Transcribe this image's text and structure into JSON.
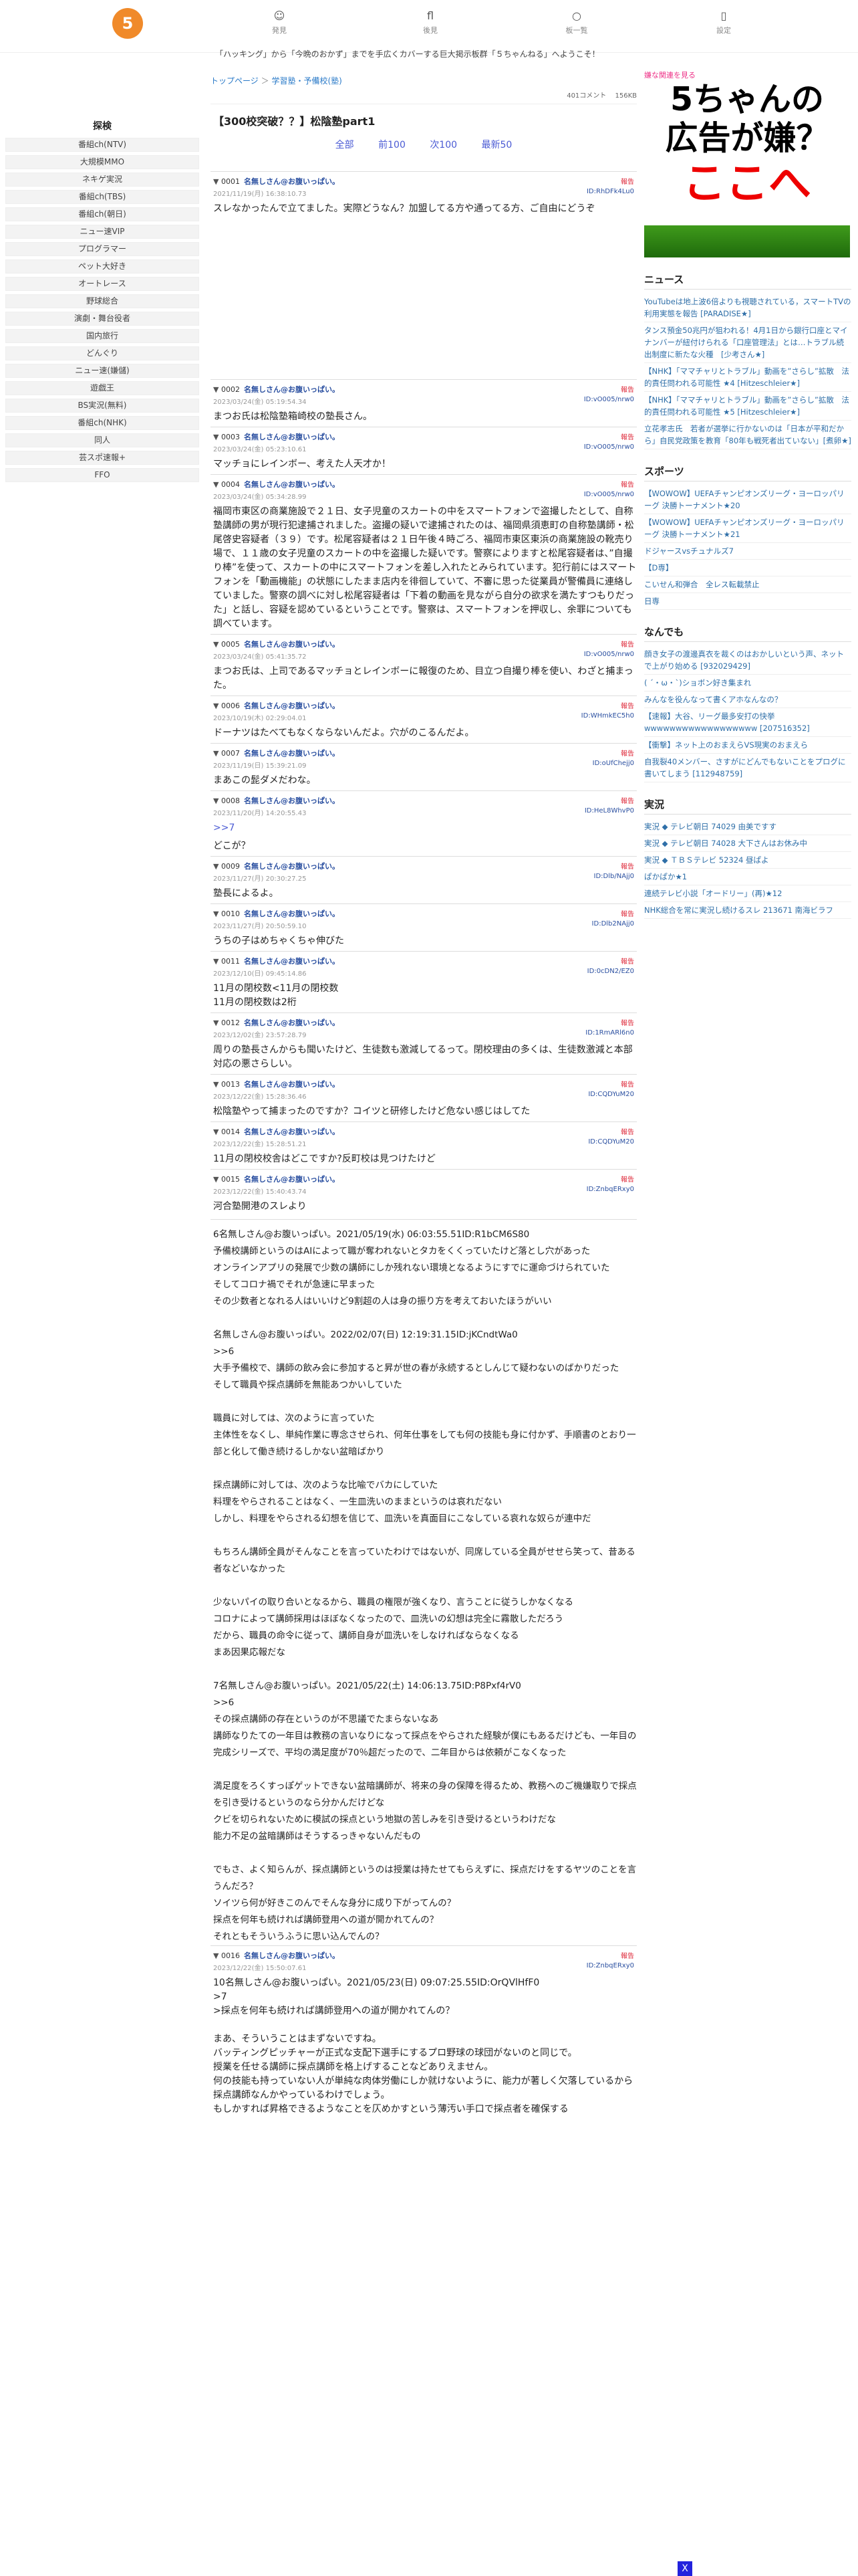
{
  "header": {
    "logo": "5",
    "nav": [
      {
        "icon": "☺",
        "label": "発見"
      },
      {
        "icon": "fl",
        "label": "後見"
      },
      {
        "icon": "○",
        "label": "板一覧"
      },
      {
        "icon": "▯",
        "label": "設定"
      }
    ],
    "ticker": "「ハッキング」から「今晩のおかず」までを手広くカバーする巨大掲示板群「５ちゃんねる」へようこそ！"
  },
  "left": {
    "title": "探検",
    "cats": [
      "番組ch(NTV)",
      "大規模MMO",
      "ネキゲ実況",
      "番組ch(TBS)",
      "番組ch(朝日)",
      "ニュー速VIP",
      "プログラマー",
      "ペット大好き",
      "オートレース",
      "野球総合",
      "演劇・舞台役者",
      "国内旅行",
      "どんぐり",
      "ニュー速(嫌儲)",
      "遊戯王",
      "BS実況(無料)",
      "番組ch(NHK)",
      "同人",
      "芸スポ速報+",
      "FFO"
    ]
  },
  "main": {
    "crumb_top": "トップページ",
    "crumb_sep": "＞",
    "crumb_board": "学習塾・予備校(塾)",
    "comments": "401コメント",
    "size": "156KB",
    "title": "【300校突破？？】松陰塾part1",
    "pager": [
      "全部",
      "前100",
      "次100",
      "最新50"
    ],
    "posts": [
      {
        "no": "0001",
        "name": "名無しさん@お腹いっぱい。",
        "date": "2021/11/19(月) 16:38:10.73",
        "id": "ID:RhDFk4Lu0",
        "body": "スレなかったんで立てました。実際どうなん？加盟してる方や通ってる方、ご自由にどうぞ",
        "tall": true
      },
      {
        "no": "0002",
        "name": "名無しさん@お腹いっぱい。",
        "date": "2023/03/24(金) 05:19:54.34",
        "id": "ID:vO005/nrw0",
        "body": "まつお氏は松陰塾箱崎校の塾長さん。"
      },
      {
        "no": "0003",
        "name": "名無しさん@お腹いっぱい。",
        "date": "2023/03/24(金) 05:23:10.61",
        "id": "ID:vO005/nrw0",
        "body": "マッチョにレインボー、考えた人天才か！"
      },
      {
        "no": "0004",
        "name": "名無しさん@お腹いっぱい。",
        "date": "2023/03/24(金) 05:34:28.99",
        "id": "ID:vO005/nrw0",
        "body": "福岡市東区の商業施設で２１日、女子児童のスカートの中をスマートフォンで盗撮したとして、自称塾講師の男が現行犯逮捕されました。盗撮の疑いで逮捕されたのは、福岡県須恵町の自称塾講師・松尾啓史容疑者（３９）です。松尾容疑者は２１日午後４時ごろ、福岡市東区東浜の商業施設の靴売り場で、１１歳の女子児童のスカートの中を盗撮した疑いです。警察によりますと松尾容疑者は、”自撮り棒”を使って、スカートの中にスマートフォンを差し入れたとみられています。犯行前にはスマートフォンを「動画機能」の状態にしたまま店内を徘徊していて、不審に思った従業員が警備員に連絡していました。警察の調べに対し松尾容疑者は「下着の動画を見ながら自分の欲求を満たすつもりだった」と話し、容疑を認めているということです。警察は、スマートフォンを押収し、余罪についても調べています。"
      },
      {
        "no": "0005",
        "name": "名無しさん@お腹いっぱい。",
        "date": "2023/03/24(金) 05:41:35.72",
        "id": "ID:vO005/nrw0",
        "body": "まつお氏は、上司であるマッチョとレインボーに報復のため、目立つ自撮り棒を使い、わざと捕まった。"
      },
      {
        "no": "0006",
        "name": "名無しさん@お腹いっぱい。",
        "date": "2023/10/19(木) 02:29:04.01",
        "id": "ID:WHmkEC5h0",
        "body": "ドーナツはたべてもなくならないんだよ。穴がのこるんだよ。"
      },
      {
        "no": "0007",
        "name": "名無しさん@お腹いっぱい。",
        "date": "2023/11/19(日) 15:39:21.09",
        "id": "ID:oUfChejj0",
        "body": "まあこの髭ダメだわな。"
      },
      {
        "no": "0008",
        "name": "名無しさん@お腹いっぱい。",
        "date": "2023/11/20(月) 14:20:55.43",
        "id": "ID:HeL8WhvP0",
        "anc": ">>7",
        "body": "どこが？"
      },
      {
        "no": "0009",
        "name": "名無しさん@お腹いっぱい。",
        "date": "2023/11/27(月) 20:30:27.25",
        "id": "ID:Dlb/NAjj0",
        "body": "塾長によるよ。"
      },
      {
        "no": "0010",
        "name": "名無しさん@お腹いっぱい。",
        "date": "2023/11/27(月) 20:50:59.10",
        "id": "ID:Dlb2NAjj0",
        "body": "うちの子はめちゃくちゃ伸びた"
      },
      {
        "no": "0011",
        "name": "名無しさん@お腹いっぱい。",
        "date": "2023/12/10(日) 09:45:14.86",
        "id": "ID:0cDN2/EZ0",
        "body": "11月の閉校数<11月の閉校数\n11月の閉校数は2桁"
      },
      {
        "no": "0012",
        "name": "名無しさん@お腹いっぱい。",
        "date": "2023/12/02(金) 23:57:28.79",
        "id": "ID:1RmARl6n0",
        "body": "周りの塾長さんからも聞いたけど、生徒数も激減してるって。閉校理由の多くは、生徒数激減と本部対応の悪さらしい。"
      },
      {
        "no": "0013",
        "name": "名無しさん@お腹いっぱい。",
        "date": "2023/12/22(金) 15:28:36.46",
        "id": "ID:CQDYuM20",
        "body": "松陰塾やって捕まったのですか？コイツと研修したけど危ない感じはしてた"
      },
      {
        "no": "0014",
        "name": "名無しさん@お腹いっぱい。",
        "date": "2023/12/22(金) 15:28:51.21",
        "id": "ID:CQDYuM20",
        "body": "11月の閉校校舎はどこですか?反町校は見つけたけど"
      },
      {
        "no": "0015",
        "name": "名無しさん@お腹いっぱい。",
        "date": "2023/12/22(金) 15:40:43.74",
        "id": "ID:ZnbqERxy0",
        "body": "河合塾開港のスレより"
      }
    ],
    "long_text": "6名無しさん@お腹いっぱい。2021/05/19(水) 06:03:55.51ID:R1bCM6S80\n予備校講師というのはAIによって職が奪われないとタカをくくっていたけど落とし穴があった\nオンラインアプリの発展で少数の講師にしか残れない環境となるようにすでに運命づけられていた\nそしてコロナ禍でそれが急速に早まった\nその少数者となれる人はいいけど9割超の人は身の振り方を考えておいたほうがいい\n\n名無しさん@お腹いっぱい。2022/02/07(日) 12:19:31.15ID:jKCndtWa0\n>>6\n大手予備校で、講師の飲み会に参加すると昇が世の春が永続するとしんじて疑わないのばかりだった\nそして職員や採点講師を無能あつかいしていた\n\n職員に対しては、次のように言っていた\n主体性をなくし、単純作業に専念させられ、何年仕事をしても何の技能も身に付かず、手順書のとおり一部と化して働き続けるしかない盆暗ばかり\n\n採点講師に対しては、次のような比喩でバカにしていた\n料理をやらされることはなく、一生皿洗いのままというのは哀れだない\nしかし、料理をやらされる幻想を信じて、皿洗いを真面目にこなしている哀れな奴らが連中だ\n\nもちろん講師全員がそんなことを言っていたわけではないが、同席している全員がせせら笑って、昔ある者などいなかった\n\n少ないパイの取り合いとなるから、職員の権限が強くなり、言うことに従うしかなくなる\nコロナによって講師採用はほぼなくなったので、皿洗いの幻想は完全に霧散しただろう\nだから、職員の命令に従って、講師自身が皿洗いをしなければならなくなる\nまあ因果応報だな\n\n7名無しさん@お腹いっぱい。2021/05/22(土) 14:06:13.75ID:P8Pxf4rV0\n>>6\nその採点講師の存在というのが不思議でたまらないなあ\n講師なりたての一年目は教務の言いなりになって採点をやらされた経験が僕にもあるだけども、一年目の完成シリーズで、平均の満足度が70％超だったので、二年目からは依頼がこなくなった\n\n満足度をろくすっぽゲットできない盆暗講師が、将来の身の保障を得るため、教務へのご機嫌取りで採点を引き受けるというのなら分かんだけどな\nクビを切られないために模試の採点という地獄の苦しみを引き受けるというわけだな\n能力不足の盆暗講師はそうするっきゃないんだもの\n\nでもさ、よく知らんが、採点講師というのは授業は持たせてもらえずに、採点だけをするヤツのことを言うんだろ？\nソイツら何が好きこのんでそんな身分に成り下がってんの？\n採点を何年も続ければ講師登用への道が開かれてんの？\nそれともそういうふうに思い込んでんの？",
    "last_post": {
      "no": "0016",
      "name": "名無しさん@お腹いっぱい。",
      "date": "2023/12/22(金) 15:50:07.61",
      "id": "ID:ZnbqERxy0",
      "body": "10名無しさん@お腹いっぱい。2021/05/23(日) 09:07:25.55ID:OrQVlHfF0\n>7\n>採点を何年も続ければ講師登用への道が開かれてんの？\n\nまあ、そういうことはまずないですね。\nバッティングピッチャーが正式な支配下選手にするプロ野球の球団がないのと同じで。\n授業を任せる講師に採点講師を格上げすることなどありえません。\n何の技能も持っていない人が単純な肉体労働にしか就けないように、能力が著しく欠落しているから採点講師なんかやっているわけでしょう。\nもしかすれば昇格できるようなことを仄めかすという薄汚い手口で採点者を確保する"
    }
  },
  "right": {
    "ad_label": "嫌な関連を見る",
    "ad_l1": "5ちゃんの",
    "ad_l2": "広告が嫌？",
    "ad_l3": "ここへ",
    "sections": [
      {
        "title": "ニュース",
        "items": [
          "YouTubeは地上波6倍よりも視聴されている，スマートTVの利用実態を報告 [PARADISE★]",
          "タンス預金50兆円が狙われる！4月1日から銀行口座とマイナンバーが紐付けられる「口座管理法」とは…トラブル続出制度に新たな火種　[少考さん★]",
          "【NHK】「ママチャリとトラブル」動画を”さらし”拡散　法的責任問われる可能性 ★4 [Hitzeschleier★]",
          "【NHK】「ママチャリとトラブル」動画を”さらし”拡散　法的責任問われる可能性 ★5 [Hitzeschleier★]",
          "立花孝志氏　若者が選挙に行かないのは「日本が平和だから」自民党政策を教育「80年も戦死者出ていない」[煮卵★]"
        ]
      },
      {
        "title": "スポーツ",
        "items": [
          "【WOWOW】UEFAチャンピオンズリーグ・ヨーロッパリーグ 決勝トーナメント★20",
          "【WOWOW】UEFAチャンピオンズリーグ・ヨーロッパリーグ 決勝トーナメント★21",
          "ドジャースvsチュナルズ7",
          "【D専】",
          "こいせん和弾合　全レス転載禁止",
          "日専"
        ]
      },
      {
        "title": "なんでも",
        "items": [
          "顔き女子の渡邊真衣を裁くのはおかしいという声、ネットで上がり始める [932029429]",
          "( ´・ω・`)ショボン好き集まれ",
          "みんなを役んなって書くアホなんなの？",
          "【速報】大谷、リーグ最多安打の快挙wwwwwwwwwwwwwwwwww [207516352]",
          "【衝撃】ネット上のおまえらVS現実のおまえら",
          "自我裂40メンバー、さすがにどんでもないことをプログに書いてしまう [112948759]"
        ]
      },
      {
        "title": "実況",
        "items": [
          "実況 ◆ テレビ朝日 74029 由美ですす",
          "実況 ◆ テレビ朝日 74028 大下さんはお休み中",
          "実況 ◆ ＴＢＳテレビ 52324 昼ぱよ",
          "ぱかぱか★1",
          "連続テレビ小説「オードリー」(再)★12",
          "NHK総合を常に実況し続けるスレ 213671 南海ビラフ"
        ]
      }
    ]
  },
  "close_label": "X"
}
